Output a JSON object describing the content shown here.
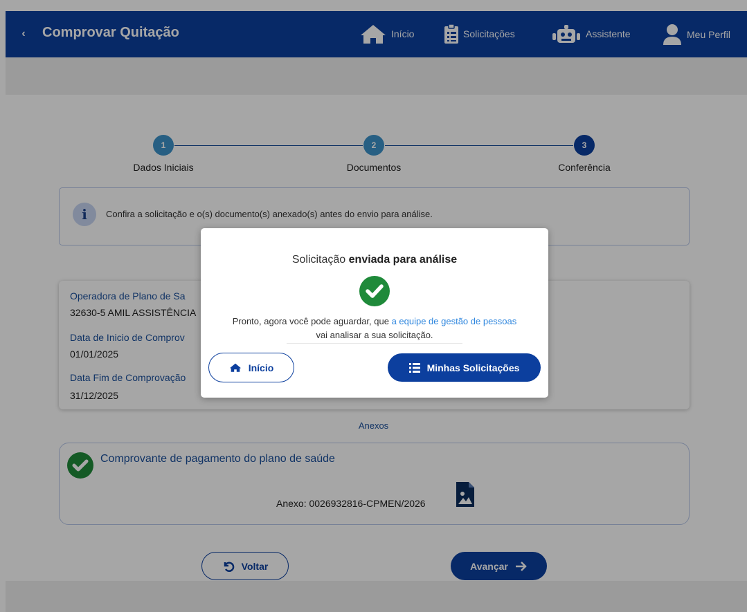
{
  "header": {
    "title": "Comprovar Quitação",
    "nav": [
      {
        "label": "Início",
        "icon": "home-icon"
      },
      {
        "label": "Solicitações",
        "icon": "clipboard-list-icon"
      },
      {
        "label": "Assistente",
        "icon": "robot-icon"
      },
      {
        "label": "Meu Perfil",
        "icon": "user-icon"
      }
    ]
  },
  "stepper": {
    "steps": [
      {
        "number": "1",
        "label": "Dados Iniciais"
      },
      {
        "number": "2",
        "label": "Documentos"
      },
      {
        "number": "3",
        "label": "Conferência"
      }
    ],
    "current_step": 3
  },
  "info": {
    "text": "Confira a solicitação e o(s) documento(s) anexado(s) antes do envio para análise."
  },
  "details": {
    "operadora_label": "Operadora de Plano de Sa",
    "operadora_value": "32630-5 AMIL ASSISTÊNCIA",
    "inicio_label": "Data de Inicio de Comprov",
    "inicio_value": "01/01/2025",
    "fim_label": "Data Fim de Comprovação",
    "fim_value": "31/12/2025"
  },
  "anexos": {
    "title": "Anexos",
    "item_title": "Comprovante de pagamento do plano de saúde",
    "file": "Anexo: 0026932816-CPMEN/2026"
  },
  "footer": {
    "back_label": "Voltar",
    "next_label": "Avançar"
  },
  "modal": {
    "title_prefix": "Solicitação ",
    "title_bold": "enviada para análise",
    "msg_part1": "Pronto, agora você pode aguardar, que ",
    "msg_link": "a equipe de gestão de pessoas",
    "msg_part2": "vai analisar a sua solicitação.",
    "home_label": "Início",
    "requests_label": "Minhas Solicitações"
  },
  "colors": {
    "primary": "#0c3f9e",
    "step_done": "#3d92c9",
    "step_current": "#0c3f9e",
    "success": "#1f8a3a",
    "link": "#2e86de"
  }
}
